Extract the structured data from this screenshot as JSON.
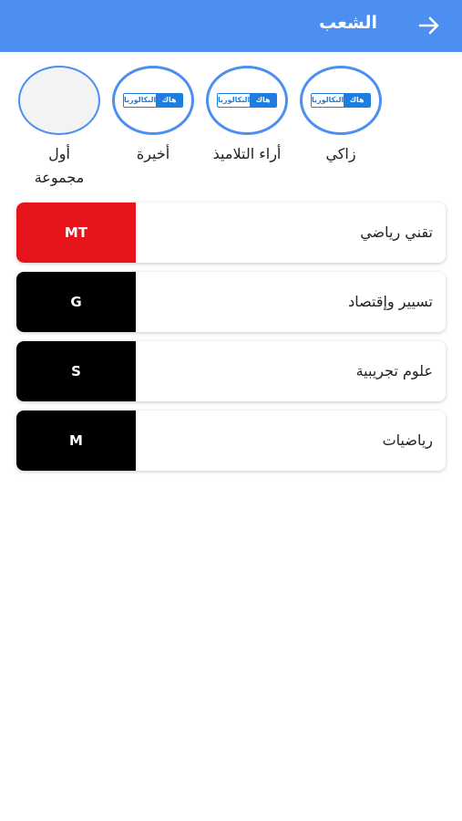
{
  "header": {
    "title": "الشعب",
    "background": "#4c8ff0",
    "back_icon": "arrow-right-icon"
  },
  "stories": [
    {
      "label": "زاكي",
      "logo_left": "البكالوريا",
      "logo_right": "هاك",
      "has_logo": true
    },
    {
      "label": "أراء التلاميذ",
      "logo_left": "البكالوريا",
      "logo_right": "هاك",
      "has_logo": true
    },
    {
      "label": "أخيرة",
      "logo_left": "البكالوريا",
      "logo_right": "هاك",
      "has_logo": true
    },
    {
      "label": "أول مجموعة",
      "has_logo": false
    }
  ],
  "branches": [
    {
      "name": "تقني رياضي",
      "code": "MT",
      "color": "#e8141b"
    },
    {
      "name": "تسيير وإقتصاد",
      "code": "G",
      "color": "#000000"
    },
    {
      "name": "علوم تجريبية",
      "code": "S",
      "color": "#000000"
    },
    {
      "name": "رياضيات",
      "code": "M",
      "color": "#000000"
    }
  ]
}
